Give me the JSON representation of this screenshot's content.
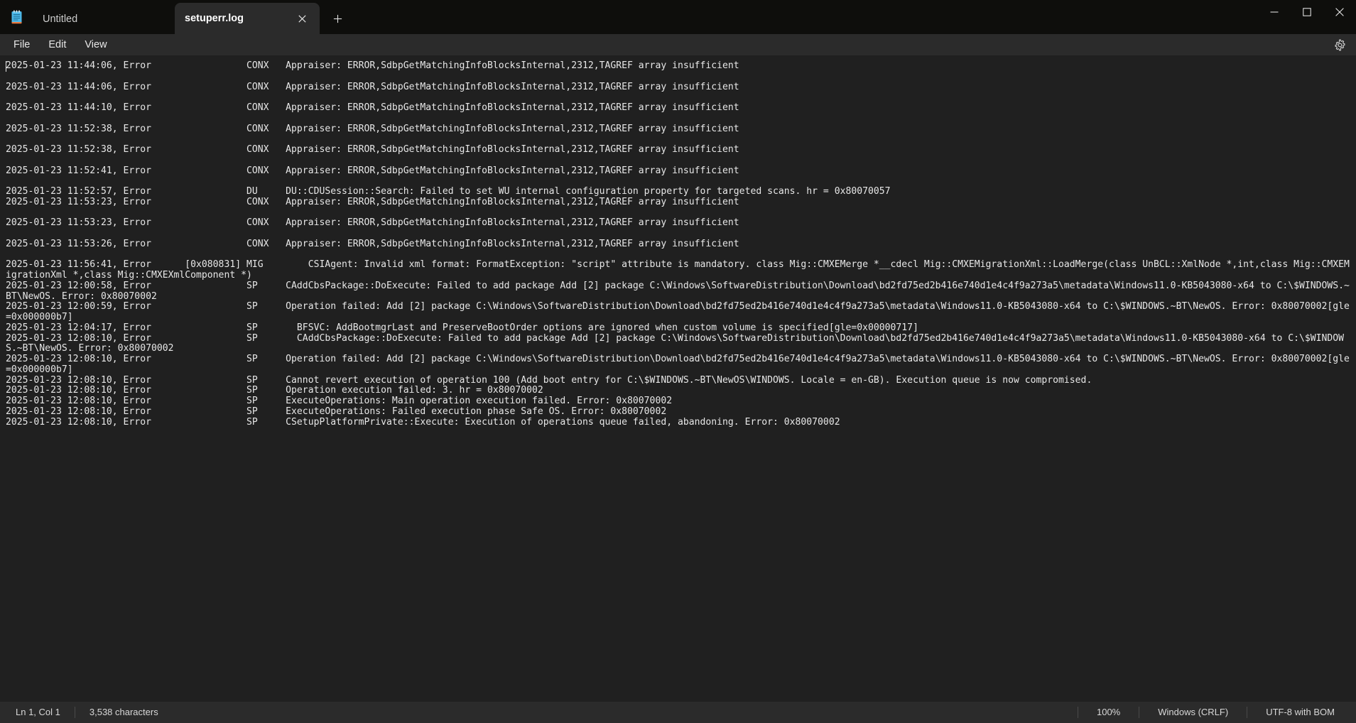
{
  "window": {
    "app_icon": "notepad-icon",
    "controls": {
      "minimize": "minimize-icon",
      "maximize": "maximize-icon",
      "close": "close-icon"
    }
  },
  "tabs": [
    {
      "label": "Untitled",
      "active": false
    },
    {
      "label": "setuperr.log",
      "active": true
    }
  ],
  "tabbar": {
    "new_tab_label": "+",
    "close_tab_label": "×"
  },
  "menubar": {
    "items": [
      {
        "label": "File"
      },
      {
        "label": "Edit"
      },
      {
        "label": "View"
      }
    ],
    "settings_icon": "gear-icon"
  },
  "editor": {
    "content": "2025-01-23 11:44:06, Error                 CONX   Appraiser: ERROR,SdbpGetMatchingInfoBlocksInternal,2312,TAGREF array insufficient\n\n2025-01-23 11:44:06, Error                 CONX   Appraiser: ERROR,SdbpGetMatchingInfoBlocksInternal,2312,TAGREF array insufficient\n\n2025-01-23 11:44:10, Error                 CONX   Appraiser: ERROR,SdbpGetMatchingInfoBlocksInternal,2312,TAGREF array insufficient\n\n2025-01-23 11:52:38, Error                 CONX   Appraiser: ERROR,SdbpGetMatchingInfoBlocksInternal,2312,TAGREF array insufficient\n\n2025-01-23 11:52:38, Error                 CONX   Appraiser: ERROR,SdbpGetMatchingInfoBlocksInternal,2312,TAGREF array insufficient\n\n2025-01-23 11:52:41, Error                 CONX   Appraiser: ERROR,SdbpGetMatchingInfoBlocksInternal,2312,TAGREF array insufficient\n\n2025-01-23 11:52:57, Error                 DU     DU::CDUSession::Search: Failed to set WU internal configuration property for targeted scans. hr = 0x80070057\n2025-01-23 11:53:23, Error                 CONX   Appraiser: ERROR,SdbpGetMatchingInfoBlocksInternal,2312,TAGREF array insufficient\n\n2025-01-23 11:53:23, Error                 CONX   Appraiser: ERROR,SdbpGetMatchingInfoBlocksInternal,2312,TAGREF array insufficient\n\n2025-01-23 11:53:26, Error                 CONX   Appraiser: ERROR,SdbpGetMatchingInfoBlocksInternal,2312,TAGREF array insufficient\n\n2025-01-23 11:56:41, Error      [0x080831] MIG        CSIAgent: Invalid xml format: FormatException: \"script\" attribute is mandatory. class Mig::CMXEMerge *__cdecl Mig::CMXEMigrationXml::LoadMerge(class UnBCL::XmlNode *,int,class Mig::CMXEMigrationXml *,class Mig::CMXEXmlComponent *)\n2025-01-23 12:00:58, Error                 SP     CAddCbsPackage::DoExecute: Failed to add package Add [2] package C:\\Windows\\SoftwareDistribution\\Download\\bd2fd75ed2b416e740d1e4c4f9a273a5\\metadata\\Windows11.0-KB5043080-x64 to C:\\$WINDOWS.~BT\\NewOS. Error: 0x80070002\n2025-01-23 12:00:59, Error                 SP     Operation failed: Add [2] package C:\\Windows\\SoftwareDistribution\\Download\\bd2fd75ed2b416e740d1e4c4f9a273a5\\metadata\\Windows11.0-KB5043080-x64 to C:\\$WINDOWS.~BT\\NewOS. Error: 0x80070002[gle=0x000000b7]\n2025-01-23 12:04:17, Error                 SP       BFSVC: AddBootmgrLast and PreserveBootOrder options are ignored when custom volume is specified[gle=0x00000717]\n2025-01-23 12:08:10, Error                 SP       CAddCbsPackage::DoExecute: Failed to add package Add [2] package C:\\Windows\\SoftwareDistribution\\Download\\bd2fd75ed2b416e740d1e4c4f9a273a5\\metadata\\Windows11.0-KB5043080-x64 to C:\\$WINDOWS.~BT\\NewOS. Error: 0x80070002\n2025-01-23 12:08:10, Error                 SP     Operation failed: Add [2] package C:\\Windows\\SoftwareDistribution\\Download\\bd2fd75ed2b416e740d1e4c4f9a273a5\\metadata\\Windows11.0-KB5043080-x64 to C:\\$WINDOWS.~BT\\NewOS. Error: 0x80070002[gle=0x000000b7]\n2025-01-23 12:08:10, Error                 SP     Cannot revert execution of operation 100 (Add boot entry for C:\\$WINDOWS.~BT\\NewOS\\WINDOWS. Locale = en-GB). Execution queue is now compromised.\n2025-01-23 12:08:10, Error                 SP     Operation execution failed: 3. hr = 0x80070002\n2025-01-23 12:08:10, Error                 SP     ExecuteOperations: Main operation execution failed. Error: 0x80070002\n2025-01-23 12:08:10, Error                 SP     ExecuteOperations: Failed execution phase Safe OS. Error: 0x80070002\n2025-01-23 12:08:10, Error                 SP     CSetupPlatformPrivate::Execute: Execution of operations queue failed, abandoning. Error: 0x80070002"
  },
  "statusbar": {
    "line_col": "Ln 1, Col 1",
    "char_count": "3,538 characters",
    "zoom": "100%",
    "line_ending": "Windows (CRLF)",
    "encoding": "UTF-8 with BOM"
  },
  "colors": {
    "titlebar_bg": "#0e0e0c",
    "chrome_bg": "#2b2b2b",
    "editor_bg": "#202020",
    "text": "#e7e7e7"
  }
}
